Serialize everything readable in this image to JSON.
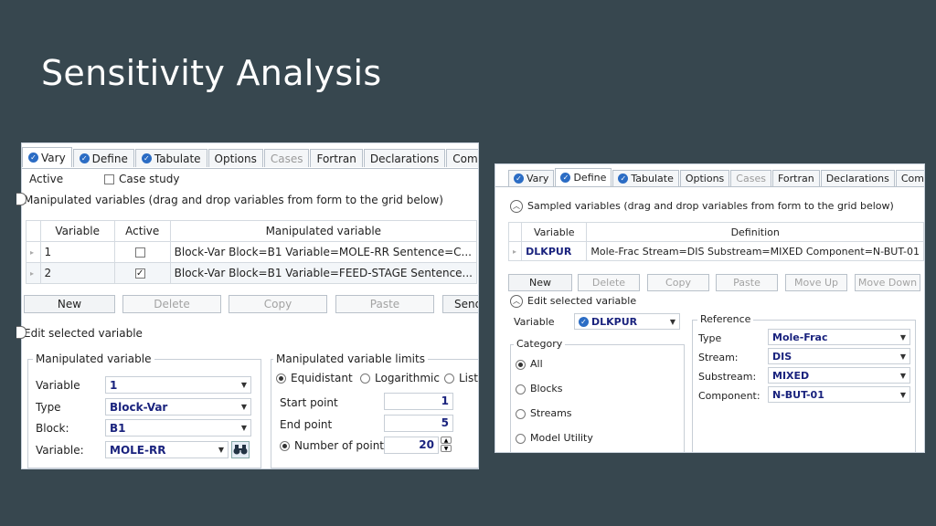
{
  "slide": {
    "title": "Sensitivity Analysis"
  },
  "left": {
    "tabs": [
      {
        "label": "Vary",
        "checked": true,
        "active": true
      },
      {
        "label": "Define",
        "checked": true
      },
      {
        "label": "Tabulate",
        "checked": true
      },
      {
        "label": "Options"
      },
      {
        "label": "Cases",
        "disabled": true
      },
      {
        "label": "Fortran"
      },
      {
        "label": "Declarations"
      },
      {
        "label": "Comments"
      }
    ],
    "active_label": "Active",
    "case_study_label": "Case study",
    "manipulated_section": "Manipulated variables (drag and drop variables from form to the grid below)",
    "grid": {
      "headers": [
        "Variable",
        "Active",
        "Manipulated variable"
      ],
      "rows": [
        {
          "variable": "1",
          "active": false,
          "definition": "Block-Var Block=B1 Variable=MOLE-RR Sentence=C..."
        },
        {
          "variable": "2",
          "active": true,
          "definition": "Block-Var Block=B1 Variable=FEED-STAGE Sentence..."
        }
      ]
    },
    "buttons": {
      "new": "New",
      "delete": "Delete",
      "copy": "Copy",
      "paste": "Paste",
      "send": "Send"
    },
    "edit_section": "Edit selected variable",
    "manip_group": {
      "label": "Manipulated variable",
      "variable_label": "Variable",
      "variable_value": "1",
      "type_label": "Type",
      "type_value": "Block-Var",
      "block_label": "Block:",
      "block_value": "B1",
      "variable2_label": "Variable:",
      "variable2_value": "MOLE-RR"
    },
    "limits_group": {
      "label": "Manipulated variable limits",
      "equidistant": "Equidistant",
      "logarithmic": "Logarithmic",
      "list": "List",
      "start_label": "Start point",
      "start_value": "1",
      "end_label": "End point",
      "end_value": "5",
      "npoints_label": "Number of points",
      "npoints_value": "20"
    }
  },
  "right": {
    "tabs": [
      {
        "label": "Vary",
        "checked": true
      },
      {
        "label": "Define",
        "checked": true,
        "active": true
      },
      {
        "label": "Tabulate",
        "checked": true
      },
      {
        "label": "Options"
      },
      {
        "label": "Cases",
        "disabled": true
      },
      {
        "label": "Fortran"
      },
      {
        "label": "Declarations"
      },
      {
        "label": "Comments"
      }
    ],
    "sampled_section": "Sampled variables (drag and drop variables from form to the grid below)",
    "grid": {
      "headers": [
        "Variable",
        "Definition"
      ],
      "rows": [
        {
          "variable": "DLKPUR",
          "definition": "Mole-Frac Stream=DIS Substream=MIXED Component=N-BUT-01"
        }
      ]
    },
    "buttons": {
      "new": "New",
      "delete": "Delete",
      "copy": "Copy",
      "paste": "Paste",
      "move_up": "Move Up",
      "move_down": "Move Down"
    },
    "edit_section": "Edit selected variable",
    "variable_label": "Variable",
    "variable_value": "DLKPUR",
    "category": {
      "label": "Category",
      "options": [
        "All",
        "Blocks",
        "Streams",
        "Model Utility"
      ],
      "selected": "All"
    },
    "reference": {
      "label": "Reference",
      "type_label": "Type",
      "type_value": "Mole-Frac",
      "stream_label": "Stream:",
      "stream_value": "DIS",
      "substream_label": "Substream:",
      "substream_value": "MIXED",
      "component_label": "Component:",
      "component_value": "N-BUT-01"
    }
  }
}
